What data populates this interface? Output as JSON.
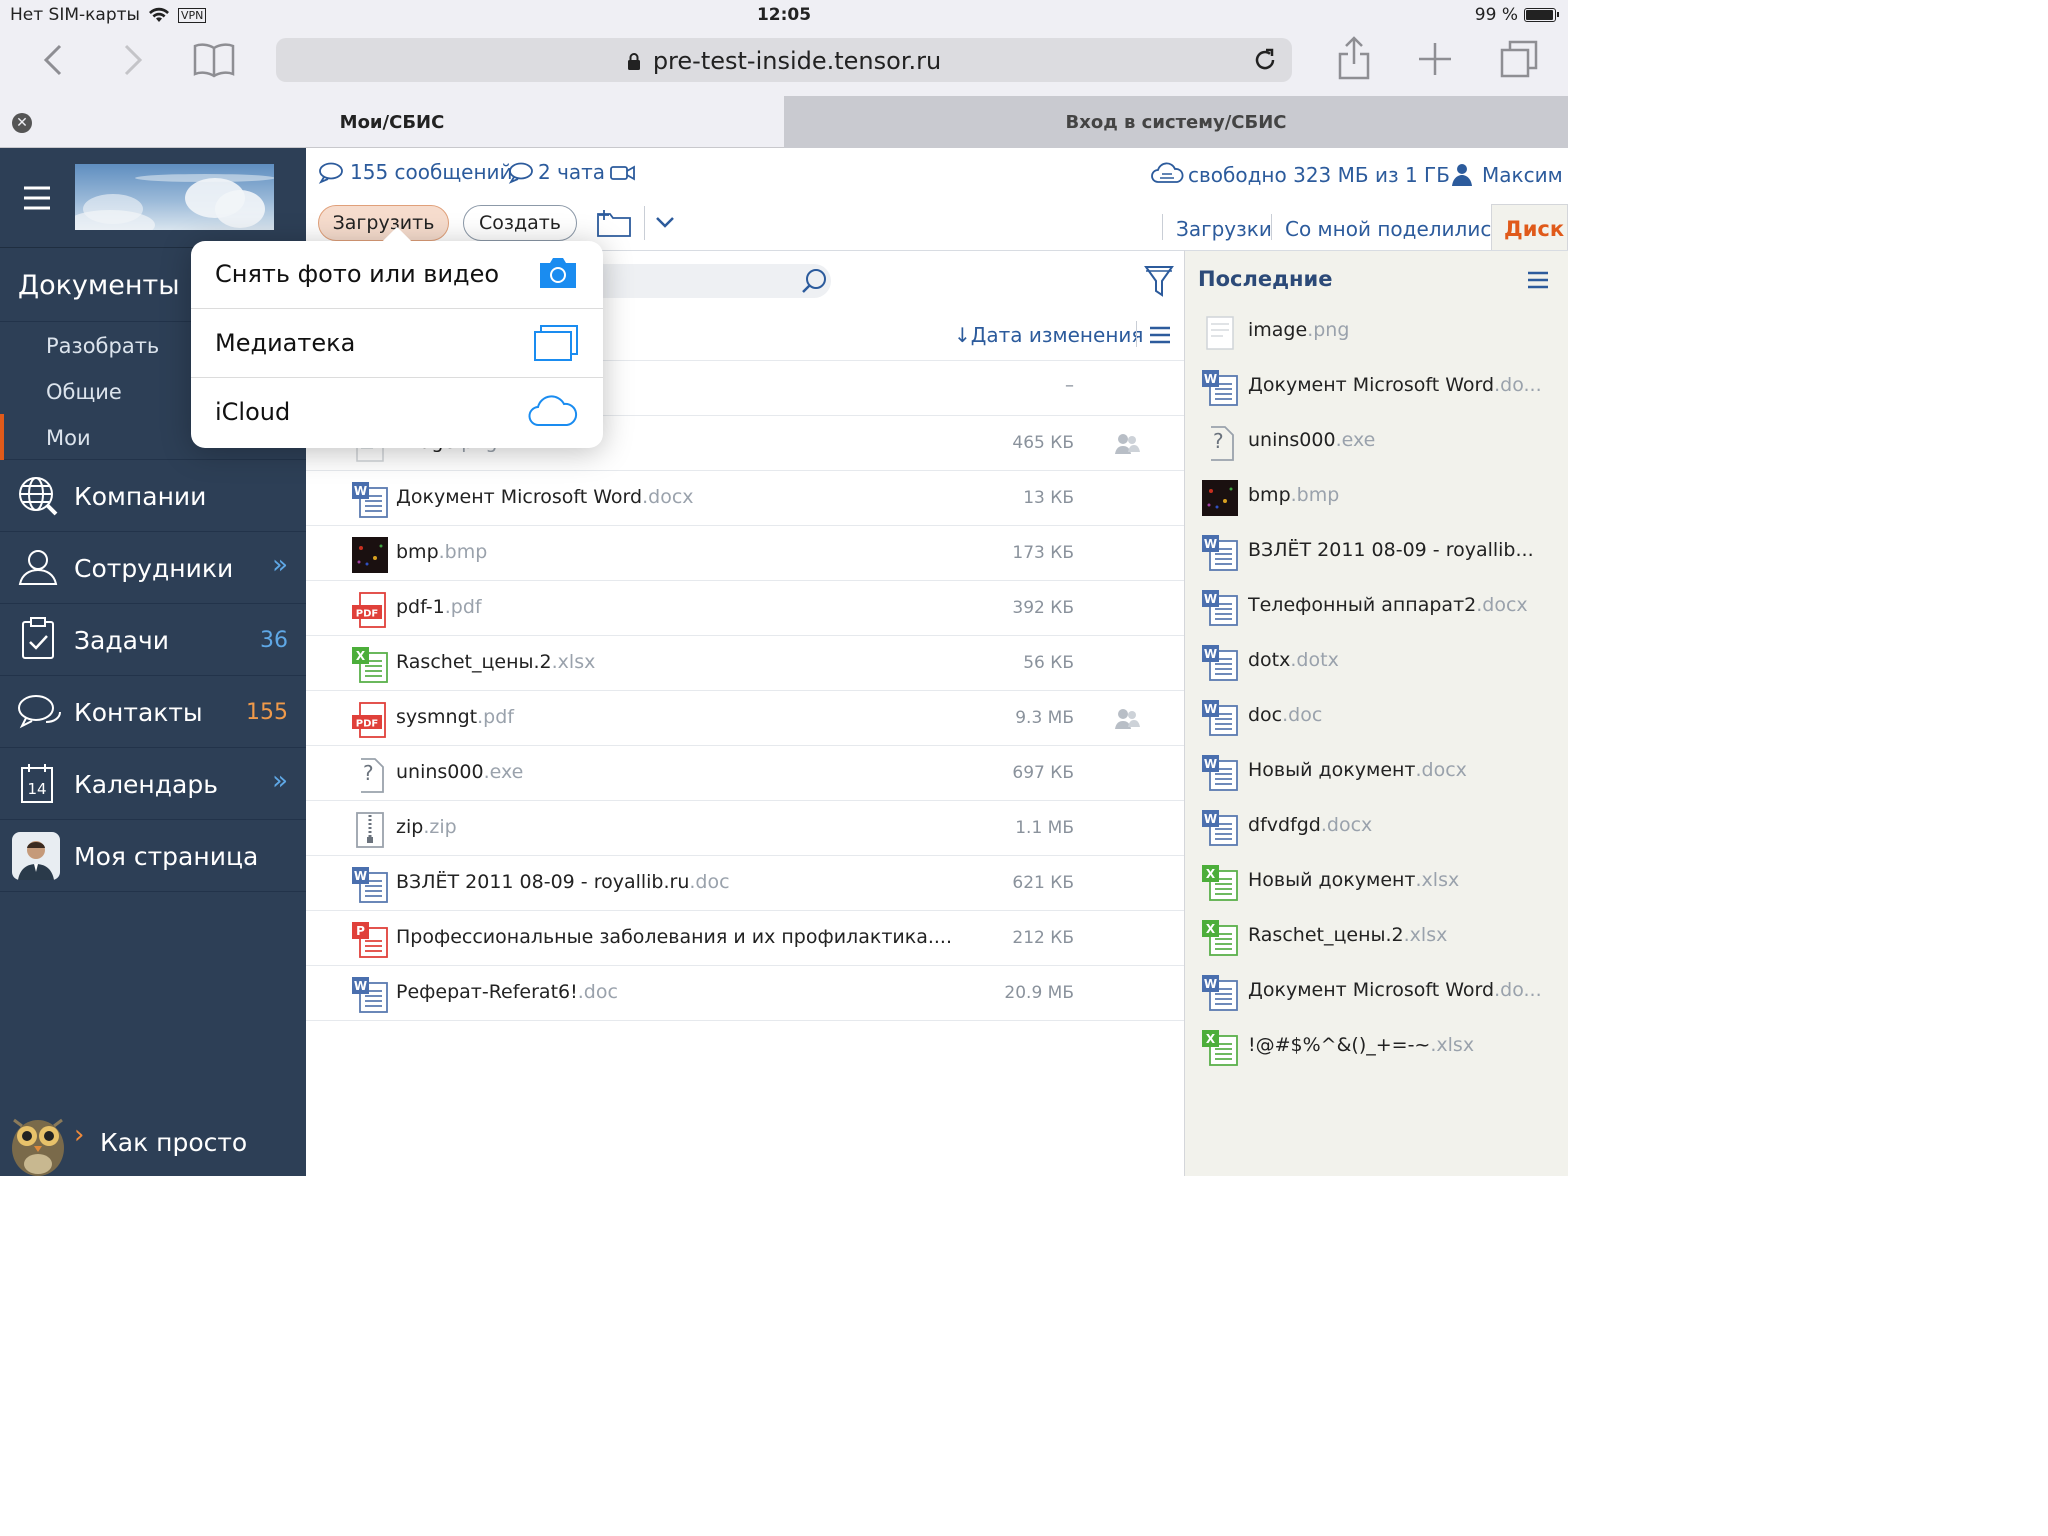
{
  "status": {
    "carrier": "Нет SIM-карты",
    "vpn": "VPN",
    "time": "12:05",
    "battery": "99 %"
  },
  "browser": {
    "url": "pre-test-inside.tensor.ru",
    "tabs": [
      {
        "label": "Мои/СБИС"
      },
      {
        "label": "Вход в систему/СБИС"
      }
    ]
  },
  "sidebar": {
    "documents": {
      "label": "Документы",
      "subs": [
        "Разобрать",
        "Общие",
        "Мои"
      ]
    },
    "items": [
      {
        "label": "Компании",
        "icon": "globe-search-icon"
      },
      {
        "label": "Сотрудники",
        "icon": "people-icon",
        "chevron": "»"
      },
      {
        "label": "Задачи",
        "icon": "clipboard-icon",
        "count": "36"
      },
      {
        "label": "Контакты",
        "icon": "chat-bubbles-icon",
        "count": "155"
      },
      {
        "label": "Календарь",
        "icon": "calendar-icon",
        "day": "14",
        "chevron": "»"
      },
      {
        "label": "Моя страница",
        "icon": "avatar"
      }
    ],
    "help": "Как просто"
  },
  "header": {
    "messages": "155 сообщений",
    "chats": "2 чата",
    "storage": "свободно 323 МБ из 1 ГБ",
    "user": "Максим",
    "upload": "Загрузить",
    "create": "Создать",
    "tabs": [
      "Загрузки",
      "Со мной поделились",
      "Диск"
    ]
  },
  "popover": [
    {
      "label": "Снять фото или видео",
      "icon": "camera-icon"
    },
    {
      "label": "Медиатека",
      "icon": "photo-library-icon"
    },
    {
      "label": "iCloud",
      "icon": "icloud-icon"
    }
  ],
  "files": {
    "sort": "Дата изменения",
    "dash": "–",
    "rows": [
      {
        "name": "image",
        "ext": ".png",
        "size": "465 КБ",
        "type": "img",
        "shared": true
      },
      {
        "name": "Документ Microsoft Word",
        "ext": ".docx",
        "size": "13 КБ",
        "type": "word"
      },
      {
        "name": "bmp",
        "ext": ".bmp",
        "size": "173 КБ",
        "type": "bmp"
      },
      {
        "name": "pdf-1",
        "ext": ".pdf",
        "size": "392 КБ",
        "type": "pdf"
      },
      {
        "name": "Raschet_цены.2",
        "ext": ".xlsx",
        "size": "56 КБ",
        "type": "xls"
      },
      {
        "name": "sysmngt",
        "ext": ".pdf",
        "size": "9.3 МБ",
        "type": "pdf",
        "shared": true
      },
      {
        "name": "unins000",
        "ext": ".exe",
        "size": "697 КБ",
        "type": "unk"
      },
      {
        "name": "zip",
        "ext": ".zip",
        "size": "1.1 МБ",
        "type": "zip"
      },
      {
        "name": "ВЗЛЁТ 2011 08-09 - royallib.ru",
        "ext": ".doc",
        "size": "621 КБ",
        "type": "word"
      },
      {
        "name": "Профессиональные заболевания и их профилактика....",
        "ext": "",
        "size": "212 КБ",
        "type": "ppt"
      },
      {
        "name": "Реферат-Referat6!",
        "ext": ".doc",
        "size": "20.9 МБ",
        "type": "word"
      }
    ]
  },
  "recent": {
    "title": "Последние",
    "items": [
      {
        "name": "image",
        "ext": ".png",
        "type": "img"
      },
      {
        "name": "Документ Microsoft Word",
        "ext": ".do...",
        "type": "word"
      },
      {
        "name": "unins000",
        "ext": ".exe",
        "type": "unk"
      },
      {
        "name": "bmp",
        "ext": ".bmp",
        "type": "bmp"
      },
      {
        "name": "ВЗЛЁТ 2011 08-09 - royallib...",
        "ext": "",
        "type": "word"
      },
      {
        "name": "Телефонный аппарат2",
        "ext": ".docx",
        "type": "word"
      },
      {
        "name": "dotx",
        "ext": ".dotx",
        "type": "word"
      },
      {
        "name": "doc",
        "ext": ".doc",
        "type": "word"
      },
      {
        "name": "Новый документ",
        "ext": ".docx",
        "type": "word"
      },
      {
        "name": "dfvdfgd",
        "ext": ".docx",
        "type": "word"
      },
      {
        "name": "Новый документ",
        "ext": ".xlsx",
        "type": "xls"
      },
      {
        "name": "Raschet_цены.2",
        "ext": ".xlsx",
        "type": "xls"
      },
      {
        "name": "Документ Microsoft Word",
        "ext": ".do...",
        "type": "word"
      },
      {
        "name": "!@#$%^&()_+=-~",
        "ext": ".xlsx",
        "type": "xls"
      }
    ]
  },
  "colors": {
    "sidebar": "#2d3f56",
    "accent": "#2c5b9c",
    "orange": "#e05a1a",
    "count": "#5fa8e6"
  }
}
